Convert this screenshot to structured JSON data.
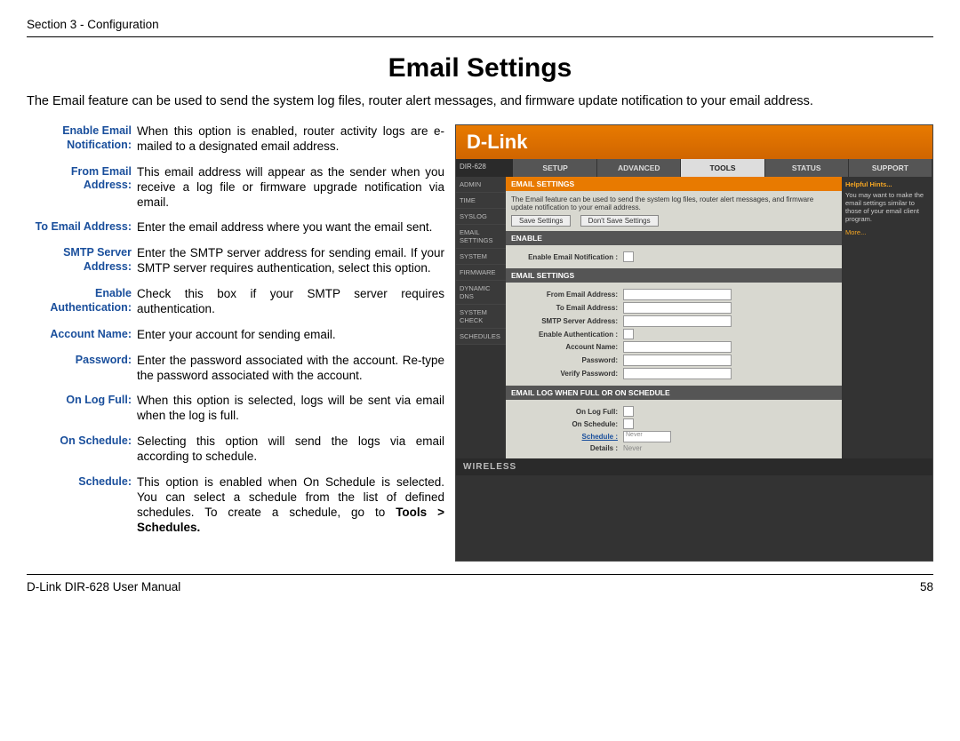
{
  "header": {
    "section": "Section 3 - Configuration"
  },
  "title": "Email Settings",
  "intro": "The Email feature can be used to send the system log files, router alert messages, and firmware update notification to your email address.",
  "defs": [
    {
      "label": "Enable Email Notification:",
      "value": "When this option is enabled, router activity logs are e-mailed to a designated email address."
    },
    {
      "label": "From Email Address:",
      "value": "This email address will appear as the sender when you receive a log file or firmware upgrade notification via email."
    },
    {
      "label": "To Email Address:",
      "value": "Enter the email address where you want the email sent."
    },
    {
      "label": "SMTP Server Address:",
      "value": "Enter the SMTP server address for sending email. If your SMTP server requires authentication, select this option."
    },
    {
      "label": "Enable Authentication:",
      "value": "Check this box if your SMTP server requires authentication."
    },
    {
      "label": "Account Name:",
      "value": "Enter your account for sending email."
    },
    {
      "label": "Password:",
      "value": "Enter the password associated with the account. Re-type the password associated with the account."
    },
    {
      "label": "On Log Full:",
      "value": "When this option is selected, logs will be sent via email when the log is full."
    },
    {
      "label": "On Schedule:",
      "value": "Selecting this option will send the logs via email according to schedule."
    },
    {
      "label": "Schedule:",
      "value_prefix": "This option is enabled when On Schedule is selected. You can select a schedule from the list of defined schedules. To create a schedule, go to ",
      "bold_suffix": "Tools > Schedules."
    }
  ],
  "router": {
    "brand": "D-Link",
    "model": "DIR-628",
    "tabs": [
      "SETUP",
      "ADVANCED",
      "TOOLS",
      "STATUS",
      "SUPPORT"
    ],
    "active_tab": "TOOLS",
    "sidenav": [
      "ADMIN",
      "TIME",
      "SYSLOG",
      "EMAIL SETTINGS",
      "SYSTEM",
      "FIRMWARE",
      "DYNAMIC DNS",
      "SYSTEM CHECK",
      "SCHEDULES"
    ],
    "sect1": {
      "title": "EMAIL SETTINGS",
      "desc": "The Email feature can be used to send the system log files, router alert messages, and firmware update notification to your email address.",
      "save_btn": "Save Settings",
      "nosave_btn": "Don't Save Settings"
    },
    "enable": {
      "title": "ENABLE",
      "label": "Enable Email Notification :"
    },
    "settings": {
      "title": "EMAIL SETTINGS",
      "f1": "From Email Address:",
      "f2": "To Email Address:",
      "f3": "SMTP Server Address:",
      "f4": "Enable Authentication :",
      "f5": "Account Name:",
      "f6": "Password:",
      "f7": "Verify Password:"
    },
    "log": {
      "title": "EMAIL LOG WHEN FULL OR ON SCHEDULE",
      "f1": "On Log Full:",
      "f2": "On Schedule:",
      "f3": "Schedule :",
      "f3_val": "Never",
      "f4": "Details :",
      "f4_val": "Never"
    },
    "hints": {
      "title": "Helpful Hints...",
      "text": "You may want to make the email settings similar to those of your email client program.",
      "more": "More..."
    },
    "footer": "WIRELESS"
  },
  "footer": {
    "left": "D-Link DIR-628 User Manual",
    "right": "58"
  }
}
